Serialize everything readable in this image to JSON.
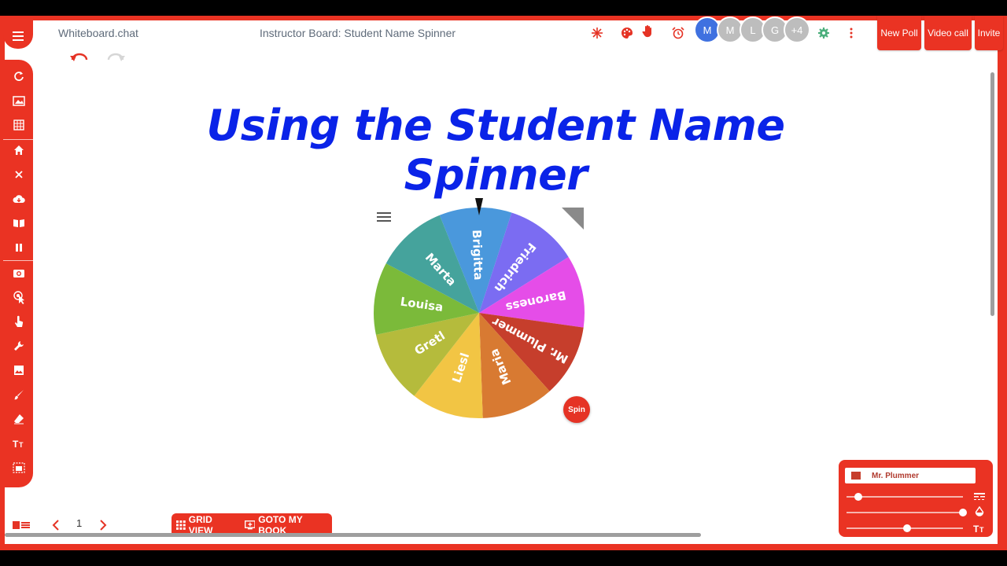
{
  "app": {
    "name": "Whiteboard.chat",
    "board_title": "Instructor Board: Student Name Spinner"
  },
  "header": {
    "avatars": [
      {
        "label": "M",
        "color": "#3f71e0"
      },
      {
        "label": "M",
        "color": "#bdbdbd"
      },
      {
        "label": "L",
        "color": "#bdbdbd"
      },
      {
        "label": "G",
        "color": "#bdbdbd"
      },
      {
        "label": "+4",
        "color": "#bdbdbd"
      }
    ],
    "buttons": {
      "new_poll": "New Poll",
      "video_call": "Video call",
      "invite": "Invite"
    }
  },
  "board": {
    "title": "Using the Student Name Spinner",
    "spin_label": "Spin",
    "wheel": {
      "segments": [
        {
          "name": "Brigitta",
          "color": "#4a98dc"
        },
        {
          "name": "Friedrich",
          "color": "#7b6cf2"
        },
        {
          "name": "Baroness",
          "color": "#e54de8"
        },
        {
          "name": "Mr. Plummer",
          "color": "#c63e2c"
        },
        {
          "name": "Maria",
          "color": "#d87a32"
        },
        {
          "name": "Liesl",
          "color": "#f2c544"
        },
        {
          "name": "Gretl",
          "color": "#b5bb3c"
        },
        {
          "name": "Louisa",
          "color": "#7bba3a"
        },
        {
          "name": "Marta",
          "color": "#45a39c"
        }
      ]
    }
  },
  "footer": {
    "page_number": "1",
    "grid_view": "GRID VIEW",
    "goto_book": "GOTO MY BOOK"
  },
  "properties": {
    "object_name": "Mr. Plummer",
    "object_color": "#c63e2c",
    "sliders": [
      {
        "name": "line-width",
        "value": 0.1
      },
      {
        "name": "opacity",
        "value": 1.0
      },
      {
        "name": "font-size",
        "value": 0.52
      }
    ]
  },
  "colors": {
    "accent": "#ea3323",
    "title": "#0a23e8"
  }
}
